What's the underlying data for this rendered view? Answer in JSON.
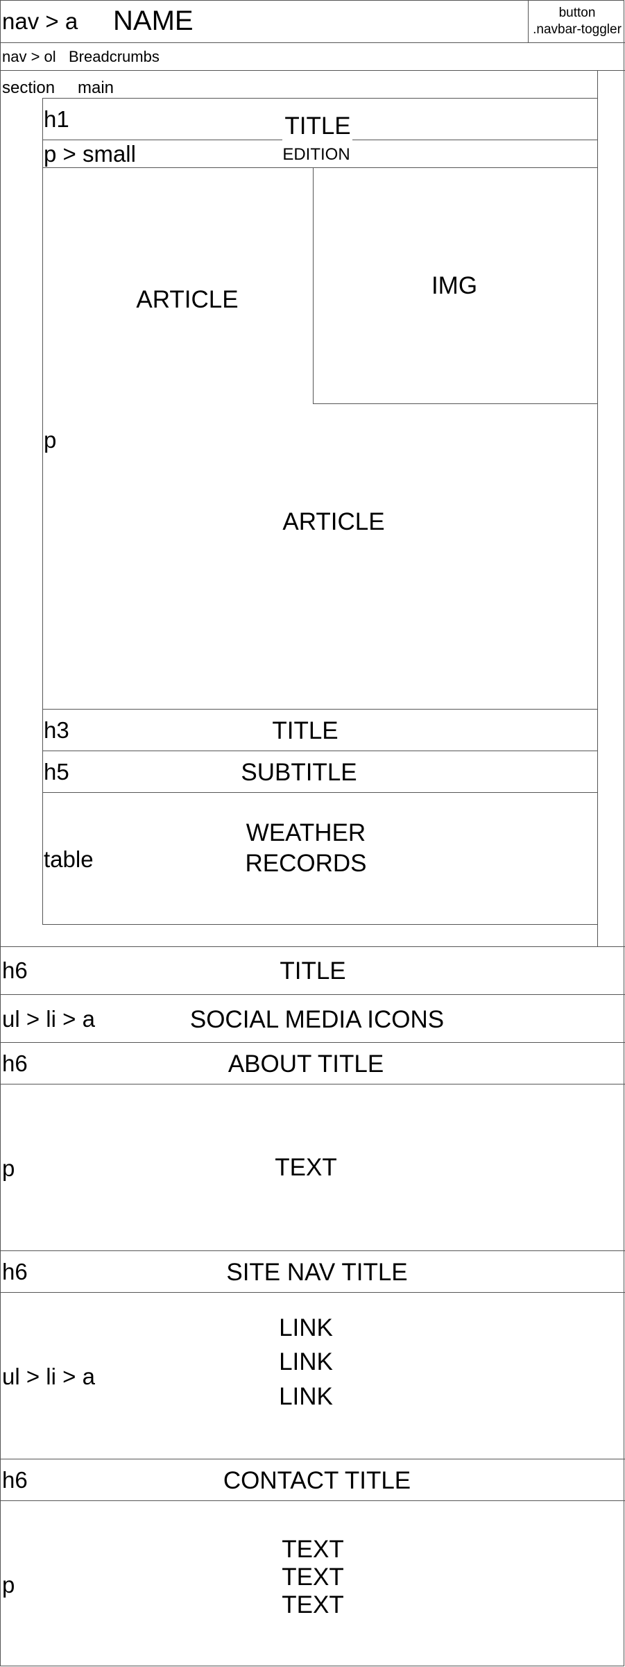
{
  "header": {
    "nav_label": "nav > a",
    "name": "NAME",
    "toggler_line1": "button",
    "toggler_line2": ".navbar-toggler"
  },
  "breadcrumb_bar": {
    "label": "nav > ol",
    "text": "Breadcrumbs"
  },
  "section": {
    "label": "section",
    "main_label": "main",
    "h1_label": "h1",
    "title": "TITLE",
    "small_label": "p > small",
    "edition": "EDITION",
    "article_top": "ARTICLE",
    "img": "IMG",
    "p_label": "p",
    "article_bottom": "ARTICLE",
    "h3_label": "h3",
    "h3_text": "TITLE",
    "h5_label": "h5",
    "h5_text": "SUBTITLE",
    "table_label": "table",
    "table_line1": "WEATHER",
    "table_line2": "RECORDS"
  },
  "footer": {
    "h6_title_label": "h6",
    "h6_title_text": "TITLE",
    "social_label": "ul > li > a",
    "social_text": "SOCIAL MEDIA ICONS",
    "about_label": "h6",
    "about_title": "ABOUT TITLE",
    "about_p_label": "p",
    "about_text": "TEXT",
    "site_nav_label": "h6",
    "site_nav_title": "SITE NAV TITLE",
    "links_label": "ul > li > a",
    "links": [
      "LINK",
      "LINK",
      "LINK"
    ],
    "contact_label": "h6",
    "contact_title": "CONTACT TITLE",
    "contact_p_label": "p",
    "contact_texts": [
      "TEXT",
      "TEXT",
      "TEXT"
    ]
  }
}
